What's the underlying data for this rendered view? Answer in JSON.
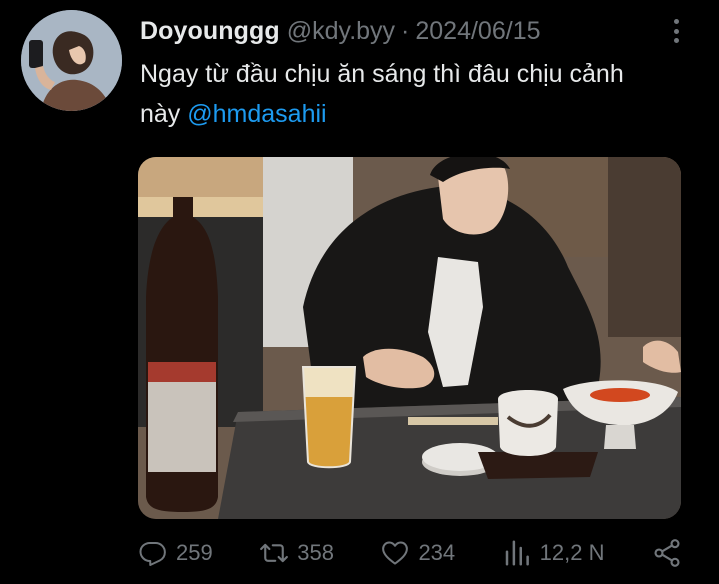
{
  "tweet": {
    "display_name": "Doyounggg",
    "handle": "@kdy.byy",
    "separator": "·",
    "date": "2024/06/15",
    "text_line1": "Ngay từ đầu chịu ăn sáng thì đâu chịu cảnh",
    "text_line2": "này",
    "mention": "@hmdasahii"
  },
  "actions": {
    "replies": "259",
    "retweets": "358",
    "likes": "234",
    "views": "12,2 N"
  },
  "icons": {
    "reply": "reply-icon",
    "retweet": "retweet-icon",
    "like": "heart-icon",
    "views": "analytics-icon",
    "share": "share-icon",
    "more": "more-vertical-icon"
  },
  "colors": {
    "background": "#000000",
    "text": "#e7e9ea",
    "secondary": "#71767b",
    "mention": "#1d9bf0"
  }
}
